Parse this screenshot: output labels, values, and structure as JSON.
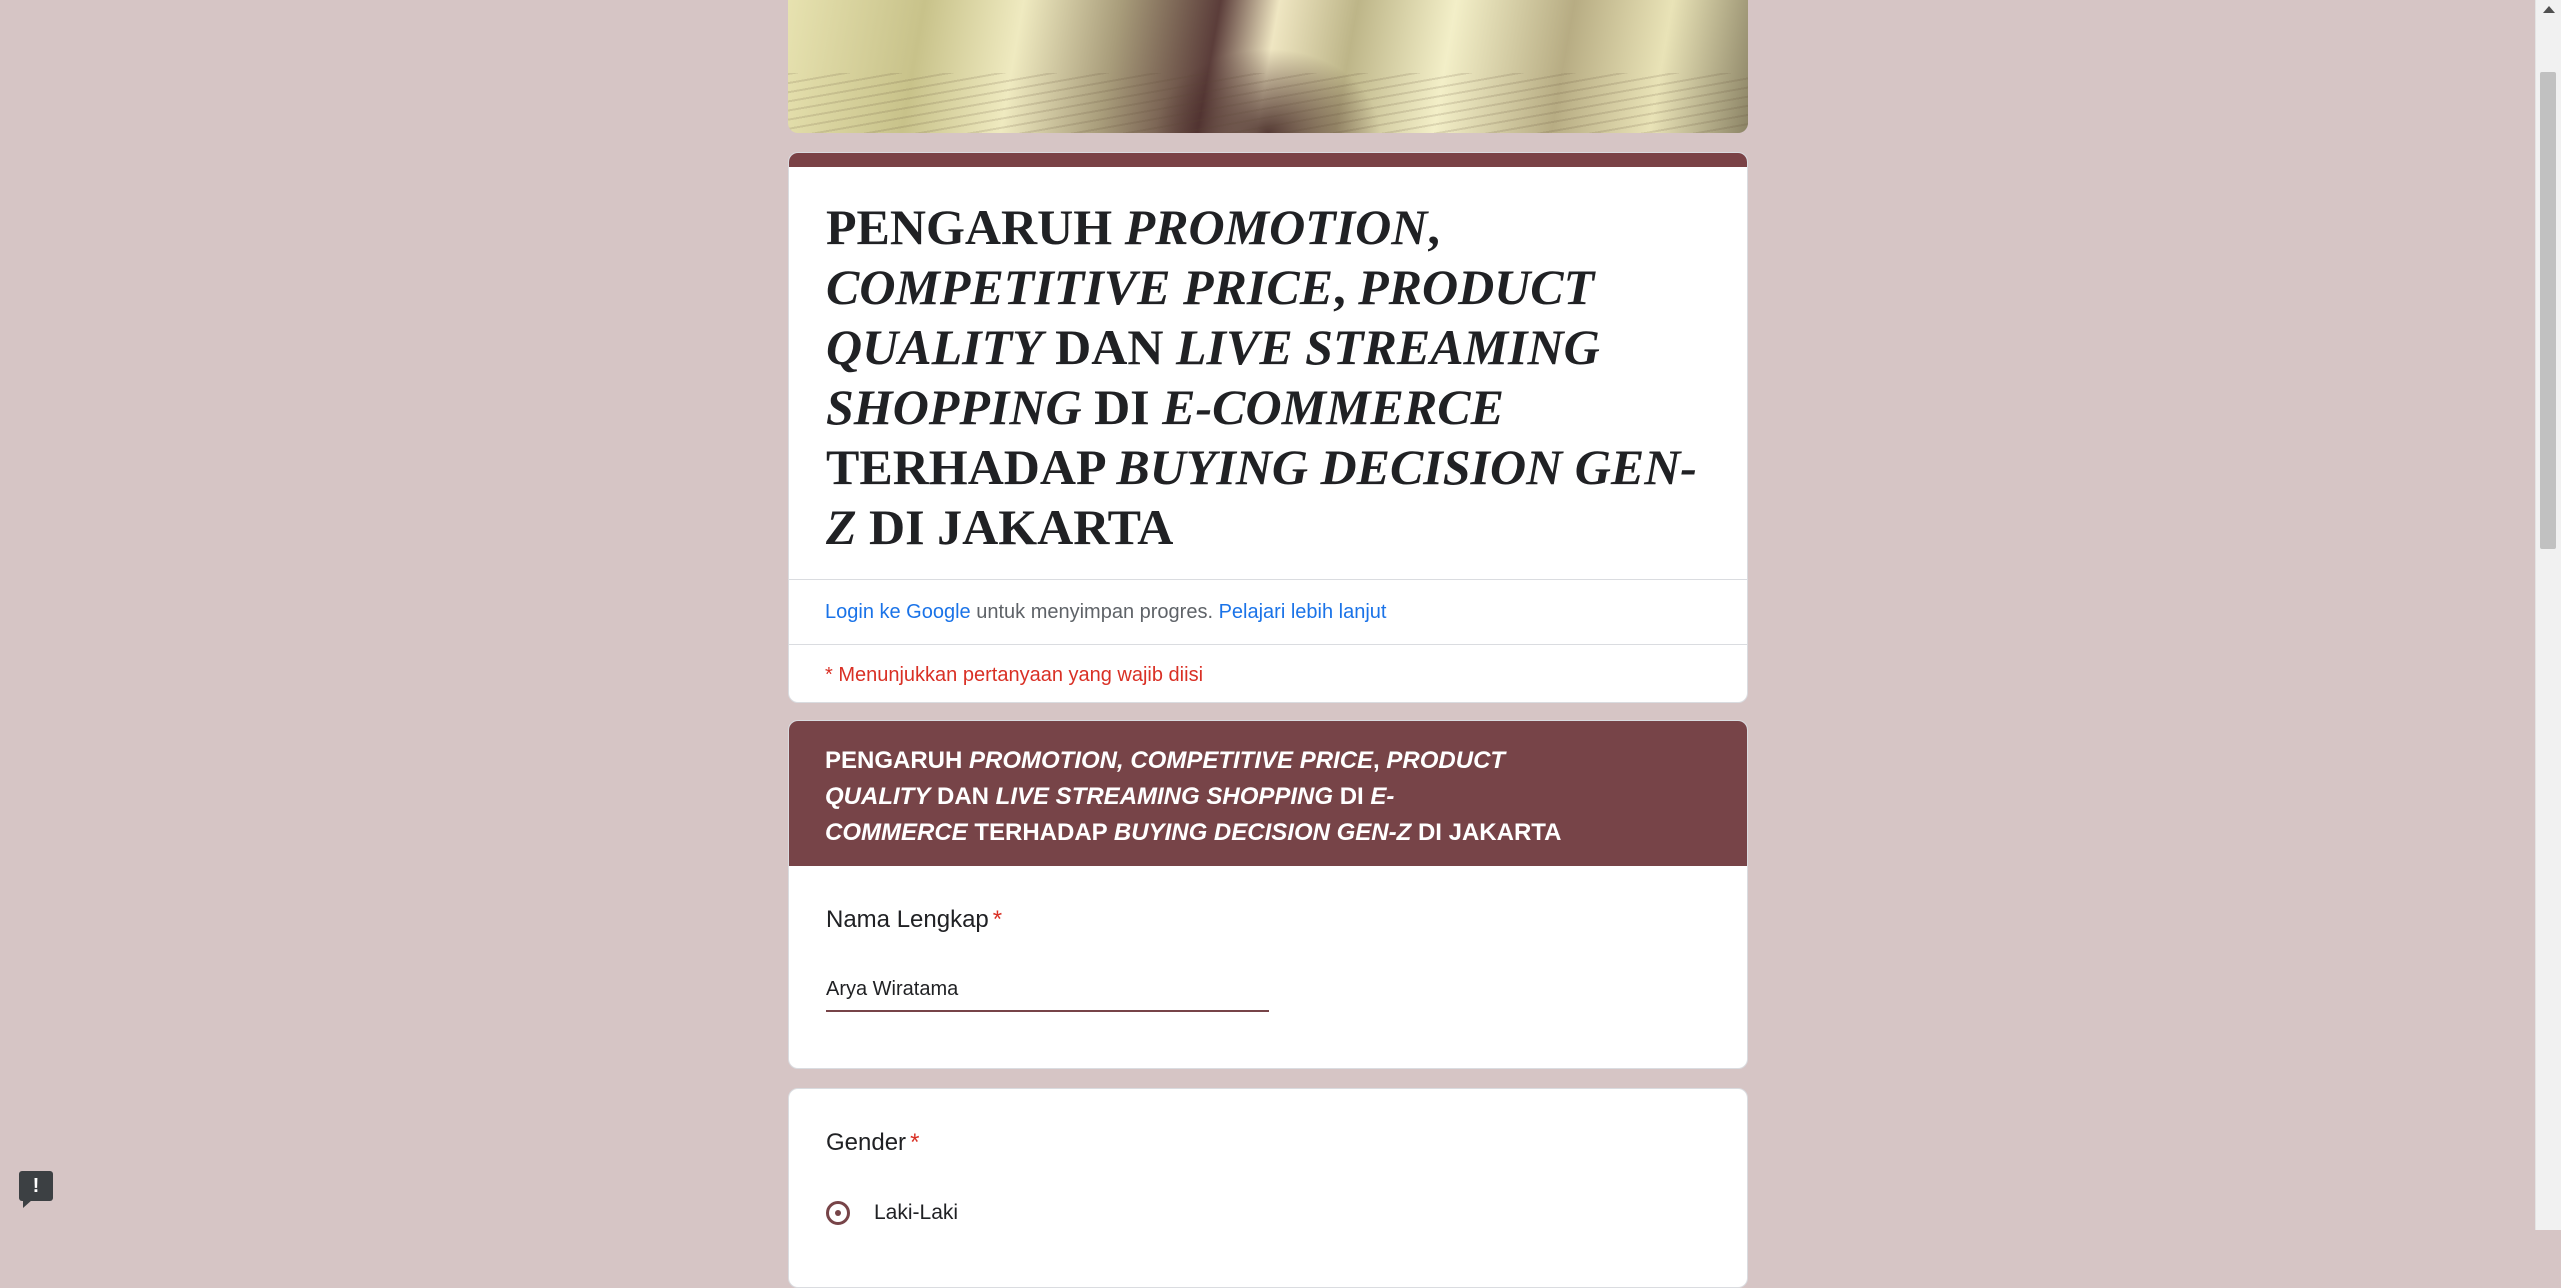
{
  "form": {
    "title_segments": [
      {
        "text": "PENGARUH ",
        "italic": false
      },
      {
        "text": "PROMOTION",
        "italic": true
      },
      {
        "text": ", ",
        "italic": false
      },
      {
        "text": "COMPETITIVE PRICE",
        "italic": true
      },
      {
        "text": ", ",
        "italic": false
      },
      {
        "text": "PRODUCT QUALITY",
        "italic": true
      },
      {
        "text": " DAN ",
        "italic": false
      },
      {
        "text": "LIVE STREAMING SHOPPING",
        "italic": true
      },
      {
        "text": " DI ",
        "italic": false
      },
      {
        "text": "E-COMMERCE",
        "italic": true
      },
      {
        "text": " TERHADAP ",
        "italic": false
      },
      {
        "text": "BUYING DECISION GEN-Z",
        "italic": true
      },
      {
        "text": " DI JAKARTA",
        "italic": false
      }
    ],
    "login_link": "Login ke Google",
    "login_text": " untuk menyimpan progres. ",
    "learn_more_link": "Pelajari lebih lanjut",
    "required_note": "* Menunjukkan pertanyaan yang wajib diisi"
  },
  "section": {
    "lines": [
      [
        {
          "text": "PENGARUH ",
          "italic": false
        },
        {
          "text": "PROMOTION, COMPETITIVE PRICE",
          "italic": true
        },
        {
          "text": ", ",
          "italic": false
        },
        {
          "text": "PRODUCT",
          "italic": true
        }
      ],
      [
        {
          "text": "QUALITY",
          "italic": true
        },
        {
          "text": " DAN ",
          "italic": false
        },
        {
          "text": "LIVE STREAMING SHOPPING",
          "italic": true
        },
        {
          "text": " DI ",
          "italic": false
        },
        {
          "text": "E-",
          "italic": true
        }
      ],
      [
        {
          "text": "COMMERCE",
          "italic": true
        },
        {
          "text": " TERHADAP ",
          "italic": false
        },
        {
          "text": "BUYING DECISION GEN-Z",
          "italic": true
        },
        {
          "text": " DI JAKARTA",
          "italic": false
        }
      ]
    ]
  },
  "questions": {
    "name": {
      "label": "Nama Lengkap",
      "required_mark": "*",
      "value": "Arya Wiratama"
    },
    "gender": {
      "label": "Gender",
      "required_mark": "*",
      "options": [
        "Laki-Laki"
      ]
    }
  },
  "feedback_icon": {
    "symbol": "!"
  },
  "colors": {
    "background": "#d6c5c5",
    "theme": "#774448",
    "link": "#1a73e8",
    "required": "#d93025"
  }
}
